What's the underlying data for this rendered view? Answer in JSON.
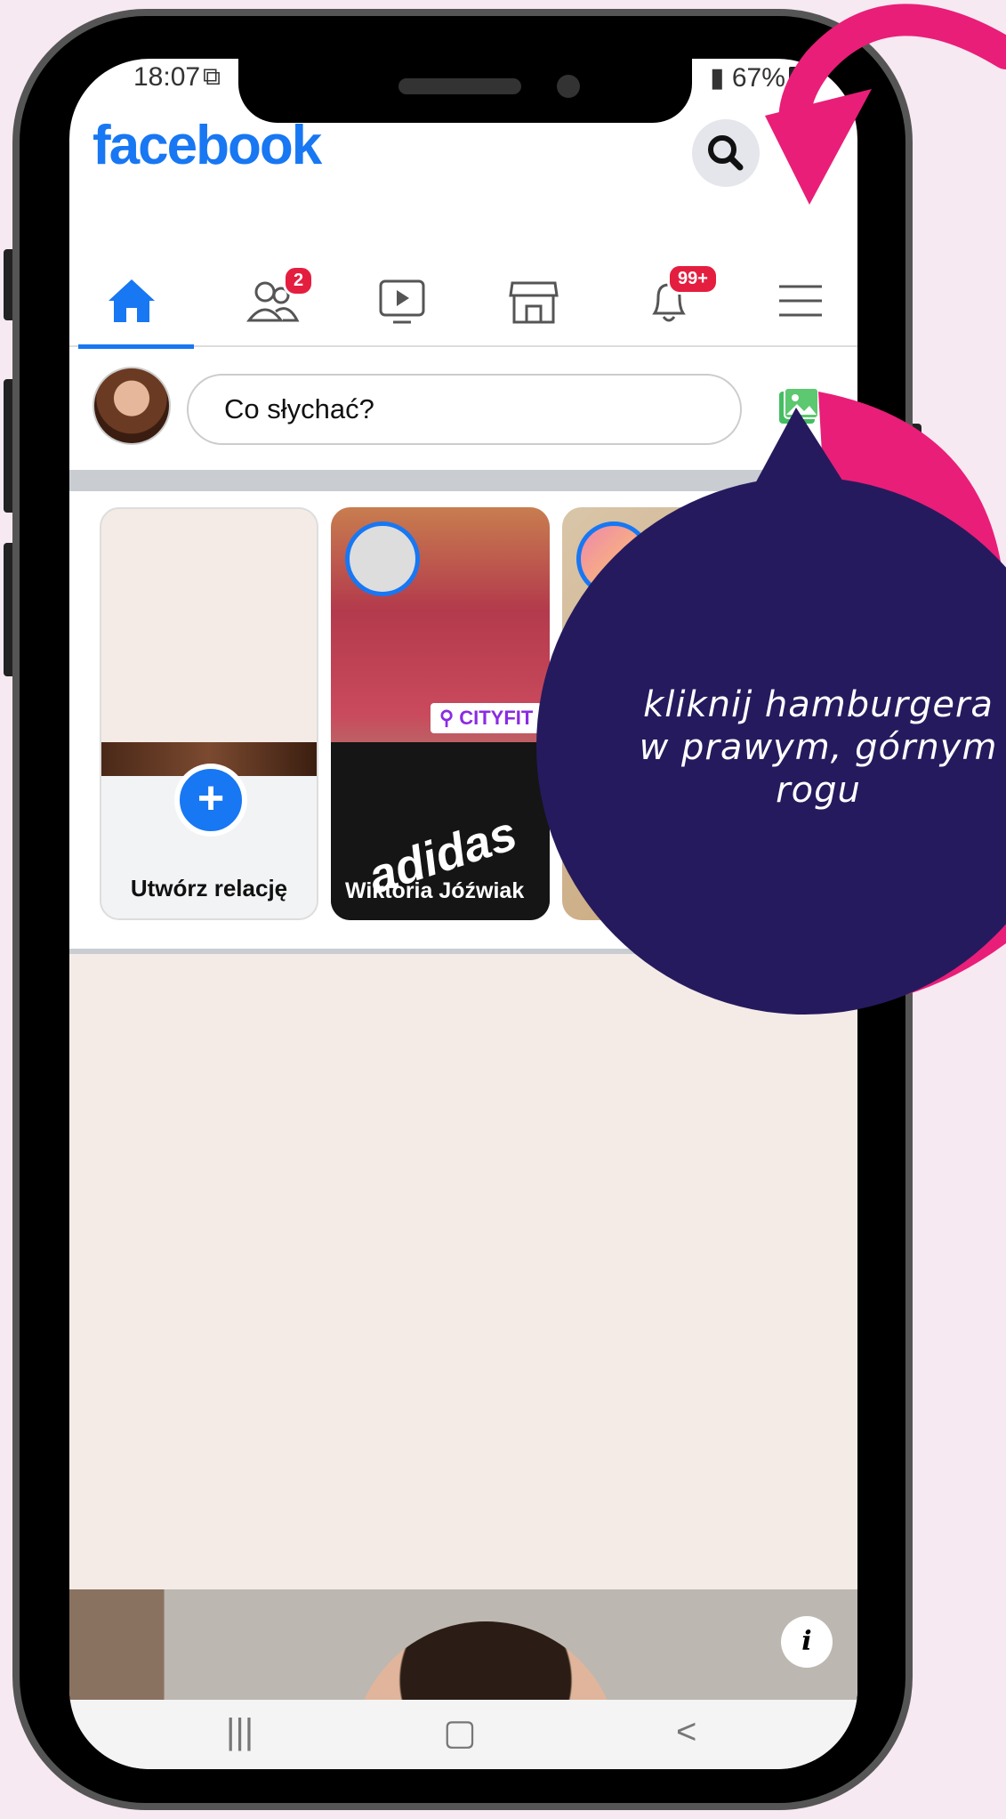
{
  "status_bar": {
    "time": "18:07",
    "screenshot_icon": "screenshot-icon",
    "battery": "67%"
  },
  "app": {
    "logo": "facebook",
    "colors": {
      "brand": "#1877f2",
      "badge": "#e41e3f",
      "annotation_bubble": "#261a5e",
      "annotation_arrow": "#e91e78"
    }
  },
  "nav": {
    "items": [
      {
        "icon": "home-icon",
        "active": true
      },
      {
        "icon": "friends-icon",
        "badge": "2"
      },
      {
        "icon": "watch-icon"
      },
      {
        "icon": "marketplace-icon"
      },
      {
        "icon": "bell-icon",
        "badge": "99+"
      },
      {
        "icon": "hamburger-menu-icon"
      }
    ]
  },
  "composer": {
    "placeholder": "Co słychać?",
    "photo_icon": "photo-icon"
  },
  "stories": {
    "create_label": "Utwórz relację",
    "items": [
      {
        "name": "Wiktoria Jóźwiak",
        "location_tag": "CITYFIT",
        "brand_text": "adidas"
      },
      {
        "name": ""
      }
    ]
  },
  "annotation": {
    "text": "kliknij hamburgera w prawym, górnym rogu"
  },
  "system_nav": {
    "recents": "|||",
    "home": "▢",
    "back": "<"
  }
}
